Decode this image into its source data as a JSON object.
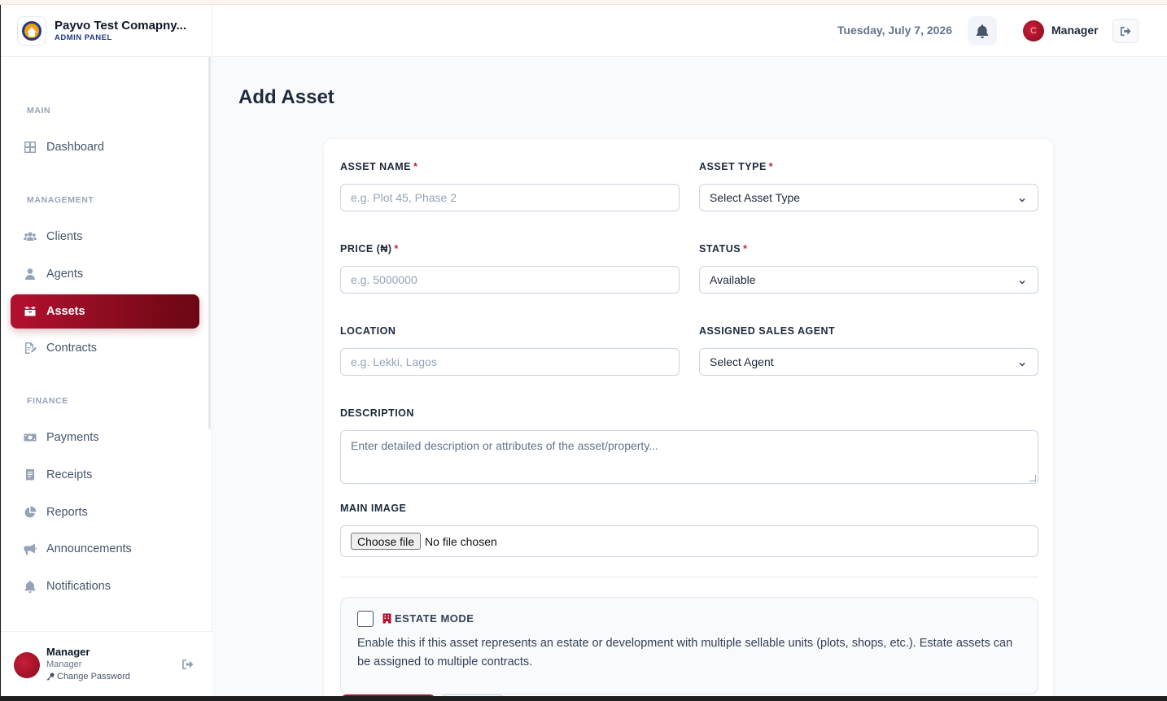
{
  "brand": {
    "title": "Payvo Test Comapny...",
    "subtitle": "ADMIN PANEL"
  },
  "sidebar": {
    "sections": {
      "main": "MAIN",
      "management": "MANAGEMENT",
      "finance": "FINANCE"
    },
    "items": [
      {
        "label": "Dashboard",
        "icon": "dashboard-icon"
      },
      {
        "label": "Clients",
        "icon": "users-icon"
      },
      {
        "label": "Agents",
        "icon": "user-icon"
      },
      {
        "label": "Assets",
        "icon": "box-icon",
        "active": true
      },
      {
        "label": "Contracts",
        "icon": "contract-icon"
      },
      {
        "label": "Payments",
        "icon": "money-icon"
      },
      {
        "label": "Receipts",
        "icon": "receipt-icon"
      },
      {
        "label": "Reports",
        "icon": "pie-chart-icon"
      },
      {
        "label": "Announcements",
        "icon": "megaphone-icon"
      },
      {
        "label": "Notifications",
        "icon": "bell-icon"
      }
    ]
  },
  "user_footer": {
    "name": "Manager",
    "role": "Manager",
    "change_password": "Change Password"
  },
  "header": {
    "date": "Tuesday, July 7, 2026",
    "user": "Manager",
    "avatar_initial": "C"
  },
  "page": {
    "title": "Add Asset"
  },
  "form": {
    "asset_name": {
      "label": "ASSET NAME",
      "placeholder": "e.g. Plot 45, Phase 2",
      "required": "*"
    },
    "asset_type": {
      "label": "ASSET TYPE",
      "value": "Select Asset Type",
      "required": "*"
    },
    "price": {
      "label": "PRICE (₦)",
      "placeholder": "e.g. 5000000",
      "required": "*"
    },
    "status": {
      "label": "STATUS",
      "value": "Available",
      "required": "*"
    },
    "location": {
      "label": "LOCATION",
      "placeholder": "e.g. Lekki, Lagos"
    },
    "agent": {
      "label": "ASSIGNED SALES AGENT",
      "value": "Select Agent"
    },
    "description": {
      "label": "DESCRIPTION",
      "placeholder": "Enter detailed description or attributes of the asset/property..."
    },
    "main_image": {
      "label": "MAIN IMAGE",
      "button": "Choose file",
      "status": "No file chosen"
    },
    "estate_mode": {
      "title": "ESTATE MODE",
      "description": "Enable this if this asset represents an estate or development with multiple sellable units (plots, shops, etc.). Estate assets can be assigned to multiple contracts."
    }
  },
  "colors": {
    "accent": "#b3102f",
    "accent_dark": "#6b0712"
  }
}
